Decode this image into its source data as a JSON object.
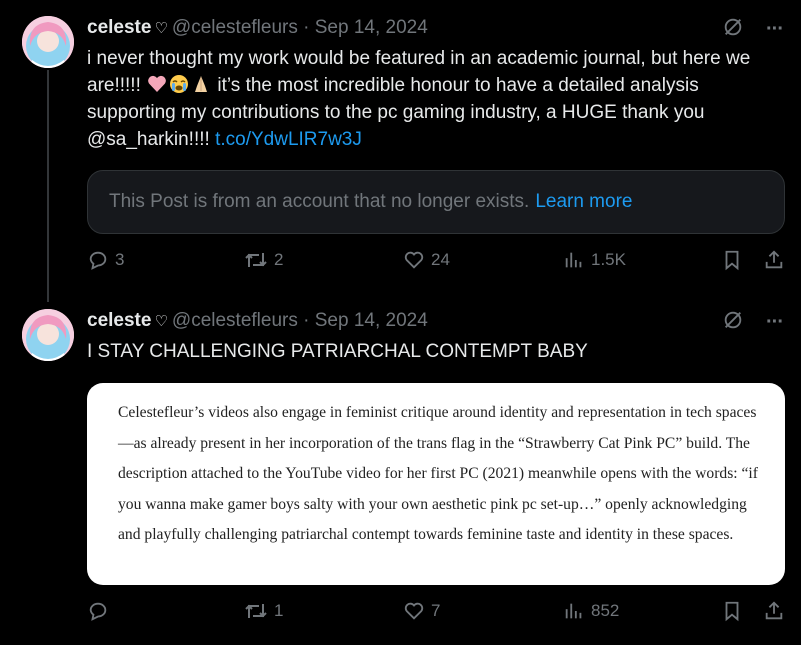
{
  "tweets": [
    {
      "name": "celeste",
      "handle": "@celestefleurs",
      "separator": "·",
      "date": "Sep 14, 2024",
      "text_before_link": "i never thought my work would be featured in an academic journal, but here we are!!!!! ",
      "text_after_emoji": " it’s the most incredible honour to have a detailed analysis supporting my contributions to the pc gaming industry, a HUGE thank you @sa_harkin!!!! ",
      "link": "t.co/YdwLIR7w3J",
      "removed_notice": "This Post is from an account that no longer exists.",
      "removed_learn_more": "Learn more",
      "replies": "3",
      "reposts": "2",
      "likes": "24",
      "views": "1.5K"
    },
    {
      "name": "celeste",
      "handle": "@celestefleurs",
      "separator": "·",
      "date": "Sep 14, 2024",
      "text": "I STAY CHALLENGING PATRIARCHAL CONTEMPT BABY",
      "image_text": "Celestefleur’s videos also engage in feminist critique around identity and representation in tech spaces—as already present in her incorporation of the trans flag in the “Strawberry Cat Pink PC” build. The description attached to the YouTube video for her first PC (2021) meanwhile opens with the words: “if you wanna make gamer boys salty with your own aesthetic pink pc set-up…” openly acknowledging and playfully challenging patriarchal contempt towards feminine taste and identity in these spaces.",
      "replies": "",
      "reposts": "1",
      "likes": "7",
      "views": "852"
    }
  ],
  "icons": {
    "name_badge": "♡",
    "grok": "grok-icon",
    "more": "···"
  },
  "colors": {
    "background": "#000000",
    "text": "#e7e9ea",
    "secondary": "#71767b",
    "link": "#1d9bf0"
  }
}
